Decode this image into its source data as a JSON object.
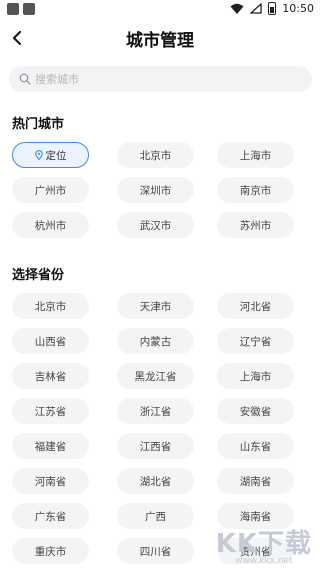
{
  "status": {
    "time": "10:50"
  },
  "header": {
    "title": "城市管理"
  },
  "search": {
    "placeholder": "搜索城市"
  },
  "hot": {
    "title": "热门城市",
    "locate_label": "定位",
    "cities": [
      "北京市",
      "上海市",
      "广州市",
      "深圳市",
      "南京市",
      "杭州市",
      "武汉市",
      "苏州市"
    ]
  },
  "provinces": {
    "title": "选择省份",
    "items": [
      "北京市",
      "天津市",
      "河北省",
      "山西省",
      "内蒙古",
      "辽宁省",
      "吉林省",
      "黑龙江省",
      "上海市",
      "江苏省",
      "浙江省",
      "安徽省",
      "福建省",
      "江西省",
      "山东省",
      "河南省",
      "湖北省",
      "湖南省",
      "广东省",
      "广西",
      "海南省",
      "重庆市",
      "四川省",
      "贵州省"
    ]
  },
  "watermark": {
    "brand": "KK下载",
    "url": "www.kkx.net"
  },
  "colors": {
    "accent": "#3d8cf0",
    "chip_bg": "#f3f4f6",
    "search_bg": "#f2f3f5"
  }
}
